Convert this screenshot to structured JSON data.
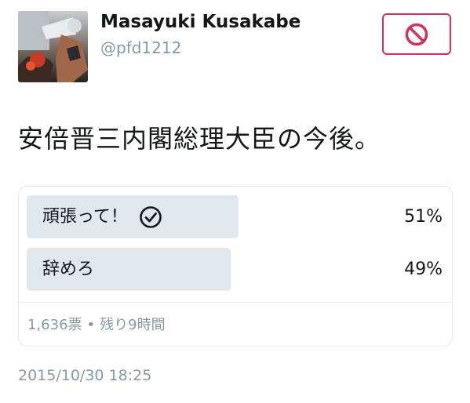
{
  "author": {
    "display_name": "Masayuki Kusakabe",
    "handle": "@pfd1212",
    "avatar": "avatar-photo"
  },
  "header_action": {
    "icon": "block-icon",
    "color": "#d0315d"
  },
  "tweet": {
    "text": "安倍晋三内閣総理大臣の今後。"
  },
  "poll": {
    "choices": [
      {
        "label": "頑張って！",
        "percent": "51%",
        "share": 0.51,
        "winner": true,
        "icon": "check-circle-icon"
      },
      {
        "label": "辞めろ",
        "percent": "49%",
        "share": 0.49,
        "winner": false
      }
    ],
    "votes": "1,636票",
    "separator": "•",
    "time_left": "残り9時間",
    "bar_color": "#e1e8ed"
  },
  "timestamp": "2015/10/30 18:25"
}
